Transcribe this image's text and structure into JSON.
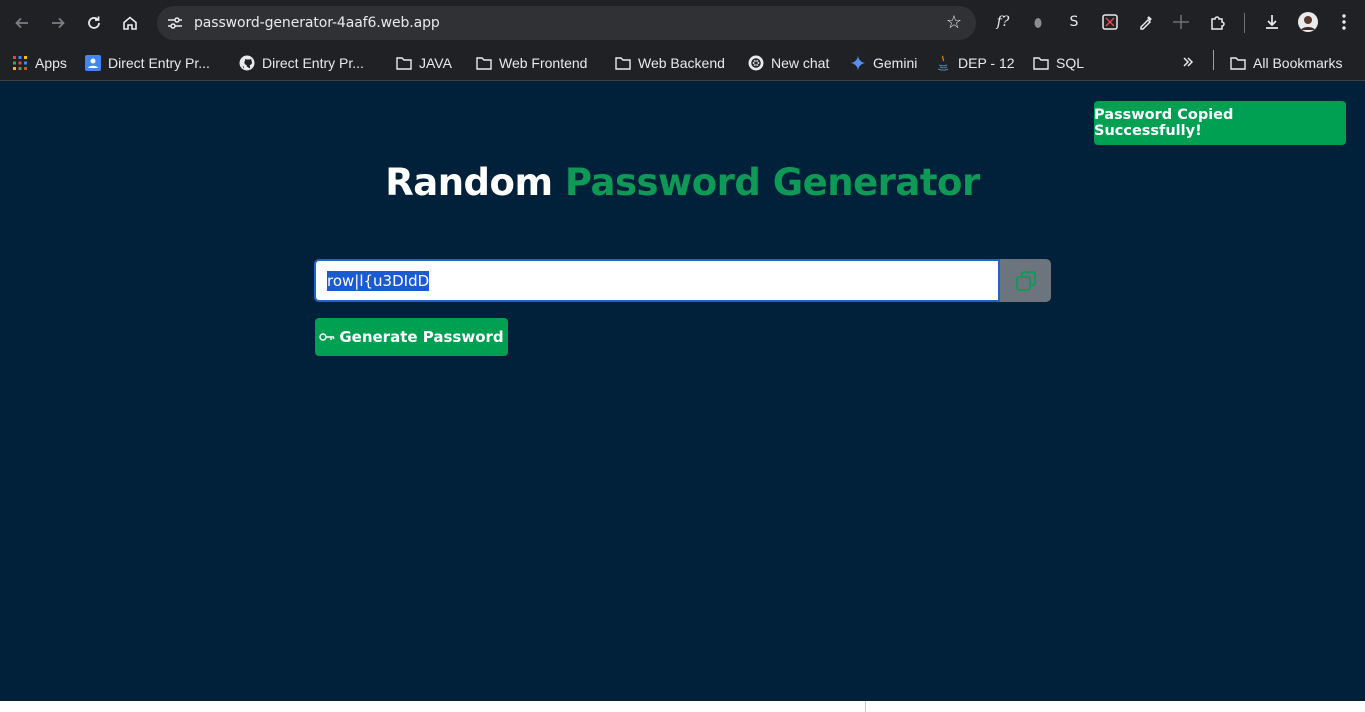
{
  "browser": {
    "url": "password-generator-4aaf6.web.app",
    "bookmarks": [
      {
        "label": "Apps",
        "icon": "apps-grid-icon"
      },
      {
        "label": "Direct Entry Pr...",
        "icon": "google-account-icon"
      },
      {
        "label": "Direct Entry Pr...",
        "icon": "github-icon"
      },
      {
        "label": "JAVA",
        "icon": "folder-icon"
      },
      {
        "label": "Web Frontend",
        "icon": "folder-icon"
      },
      {
        "label": "Web Backend",
        "icon": "folder-icon"
      },
      {
        "label": "New chat",
        "icon": "openai-icon"
      },
      {
        "label": "Gemini",
        "icon": "gemini-icon"
      },
      {
        "label": "DEP - 12",
        "icon": "java-icon"
      },
      {
        "label": "SQL",
        "icon": "folder-icon"
      }
    ],
    "all_bookmarks": "All Bookmarks",
    "extension_labels": {
      "formula": "f?",
      "s": "S"
    }
  },
  "page": {
    "toast": "Password Copied Successfully!",
    "title_part1": "Random",
    "title_part2": "Password Generator",
    "password_value": "row|l{u3DIdD",
    "generate_label": "Generate Password",
    "generate_icon": "key-icon"
  },
  "colors": {
    "page_bg": "#002139",
    "accent_green": "#0e9a56",
    "button_green": "#00a052",
    "copy_btn_gray": "#6c757d",
    "selection_blue": "#1b5bd1"
  }
}
